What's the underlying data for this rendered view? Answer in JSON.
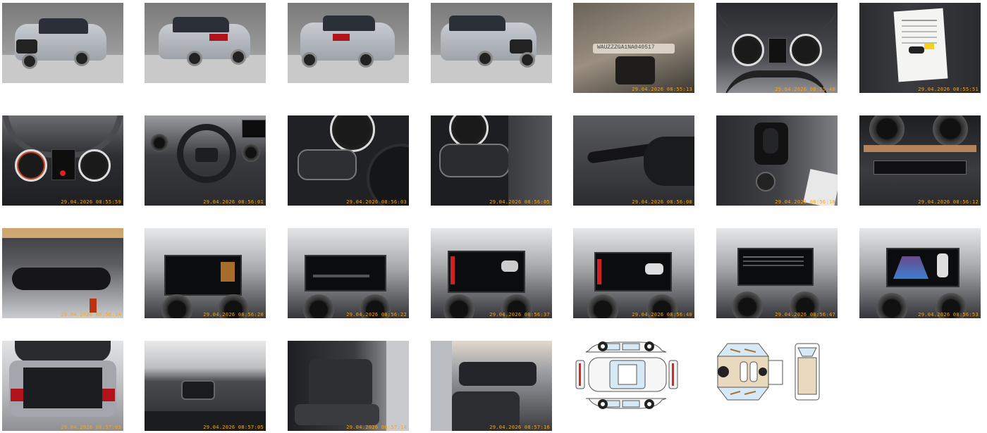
{
  "gallery": {
    "thumbnails": [
      {
        "name": "exterior-front-left",
        "timestamp": ""
      },
      {
        "name": "exterior-rear-left",
        "timestamp": ""
      },
      {
        "name": "exterior-rear-right",
        "timestamp": ""
      },
      {
        "name": "exterior-front-right",
        "timestamp": ""
      },
      {
        "name": "vin-plate",
        "timestamp": "29.04.2026 08:55:13",
        "overlay": "WAUZZZGA1NA040517"
      },
      {
        "name": "instrument-cluster-odometer",
        "timestamp": "29.04.2026 08:55:40"
      },
      {
        "name": "documents-and-keys",
        "timestamp": "29.04.2026 08:55:51"
      },
      {
        "name": "instrument-cluster",
        "timestamp": "29.04.2026 08:55:59"
      },
      {
        "name": "steering-wheel-dashboard",
        "timestamp": "29.04.2026 08:56:01"
      },
      {
        "name": "steering-wheel-left-controls",
        "timestamp": "29.04.2026 08:56:03"
      },
      {
        "name": "steering-wheel-right-controls",
        "timestamp": "29.04.2026 08:56:05"
      },
      {
        "name": "stalk-controls",
        "timestamp": "29.04.2026 08:56:08"
      },
      {
        "name": "center-console-gear-selector",
        "timestamp": "29.04.2026 08:56:10"
      },
      {
        "name": "climate-controls",
        "timestamp": "29.04.2026 08:56:12"
      },
      {
        "name": "rear-view-mirror",
        "timestamp": "29.04.2026 08:56:14"
      },
      {
        "name": "infotainment-radio",
        "timestamp": "29.04.2026 08:56:20"
      },
      {
        "name": "infotainment-menu",
        "timestamp": "29.04.2026 08:56:22"
      },
      {
        "name": "infotainment-driver-assist",
        "timestamp": "29.04.2026 08:56:37"
      },
      {
        "name": "infotainment-parking",
        "timestamp": "29.04.2026 08:56:40"
      },
      {
        "name": "infotainment-settings",
        "timestamp": "29.04.2026 08:56:47"
      },
      {
        "name": "infotainment-rear-camera",
        "timestamp": "29.04.2026 08:56:53"
      },
      {
        "name": "trunk-open",
        "timestamp": "29.04.2026 08:57:03"
      },
      {
        "name": "trunk-buttons",
        "timestamp": "29.04.2026 08:57:05"
      },
      {
        "name": "rear-seats",
        "timestamp": "29.04.2026 08:57:14"
      },
      {
        "name": "front-interior",
        "timestamp": "29.04.2026 08:57:16"
      }
    ],
    "diagrams": [
      {
        "name": "exterior-damage-diagram"
      },
      {
        "name": "interior-damage-diagram"
      }
    ]
  },
  "colors": {
    "timestamp": "#f5a623",
    "car_silver": "#b9bec5",
    "diagram_blue": "#d6e9f7",
    "diagram_tan": "#e8d9bf",
    "diagram_red": "#cc2b2b"
  }
}
